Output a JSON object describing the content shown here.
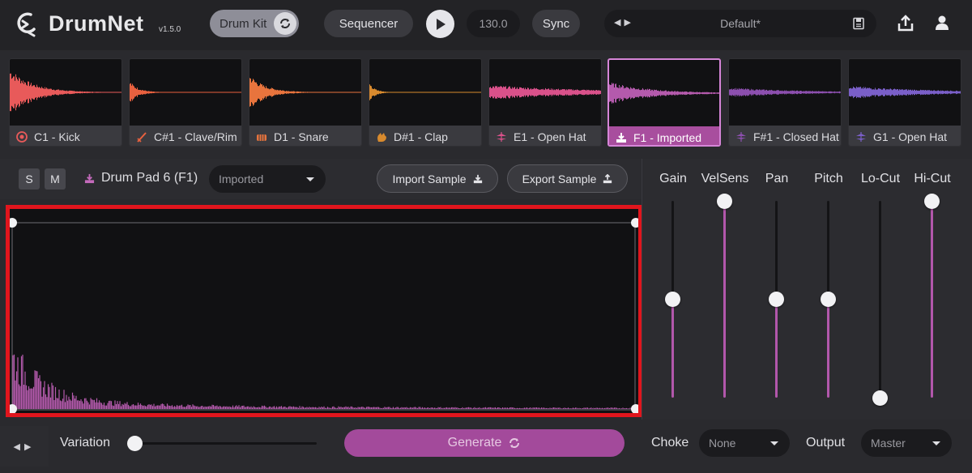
{
  "header": {
    "app_name": "DrumNet",
    "version": "v1.5.0",
    "kit_label": "Drum Kit",
    "sequencer_label": "Sequencer",
    "bpm": "130.0",
    "sync_label": "Sync",
    "preset_name": "Default*",
    "icons": [
      "drumnet-logo-icon",
      "refresh-icon",
      "play-icon",
      "prev-next-icon",
      "save-icon",
      "share-icon",
      "user-icon"
    ]
  },
  "pads": [
    {
      "label": "C1 - Kick",
      "icon": "kick-icon",
      "color": "#e85a5a"
    },
    {
      "label": "C#1 - Clave/Rim",
      "icon": "clave-icon",
      "color": "#e8613f"
    },
    {
      "label": "D1 - Snare",
      "icon": "snare-icon",
      "color": "#e8743d"
    },
    {
      "label": "D#1 - Clap",
      "icon": "clap-icon",
      "color": "#d88a2e"
    },
    {
      "label": "E1 - Open Hat",
      "icon": "hihat-icon",
      "color": "#d9518a"
    },
    {
      "label": "F1 - Imported",
      "icon": "import-icon",
      "color": "#b45aac",
      "selected": true
    },
    {
      "label": "F#1 - Closed Hat",
      "icon": "hihat-icon",
      "color": "#8c4fae"
    },
    {
      "label": "G1 - Open Hat",
      "icon": "hihat-icon",
      "color": "#7a5fc8"
    }
  ],
  "editor": {
    "solo_label": "S",
    "mute_label": "M",
    "pad_title": "Drum Pad 6 (F1)",
    "type_value": "Imported",
    "import_label": "Import Sample",
    "export_label": "Export Sample",
    "waveform_color": "#b45aac",
    "highlight_color": "#e1151d"
  },
  "controls": [
    {
      "label": "Gain",
      "level": 0.5
    },
    {
      "label": "VelSens",
      "level": 1.0
    },
    {
      "label": "Pan",
      "level": 0.5
    },
    {
      "label": "Pitch",
      "level": 0.5
    },
    {
      "label": "Lo-Cut",
      "level": 0.0
    },
    {
      "label": "Hi-Cut",
      "level": 1.0
    }
  ],
  "bottom": {
    "variation_label": "Variation",
    "variation_level": 0.0,
    "generate_label": "Generate",
    "choke_label": "Choke",
    "choke_value": "None",
    "output_label": "Output",
    "output_value": "Master"
  }
}
